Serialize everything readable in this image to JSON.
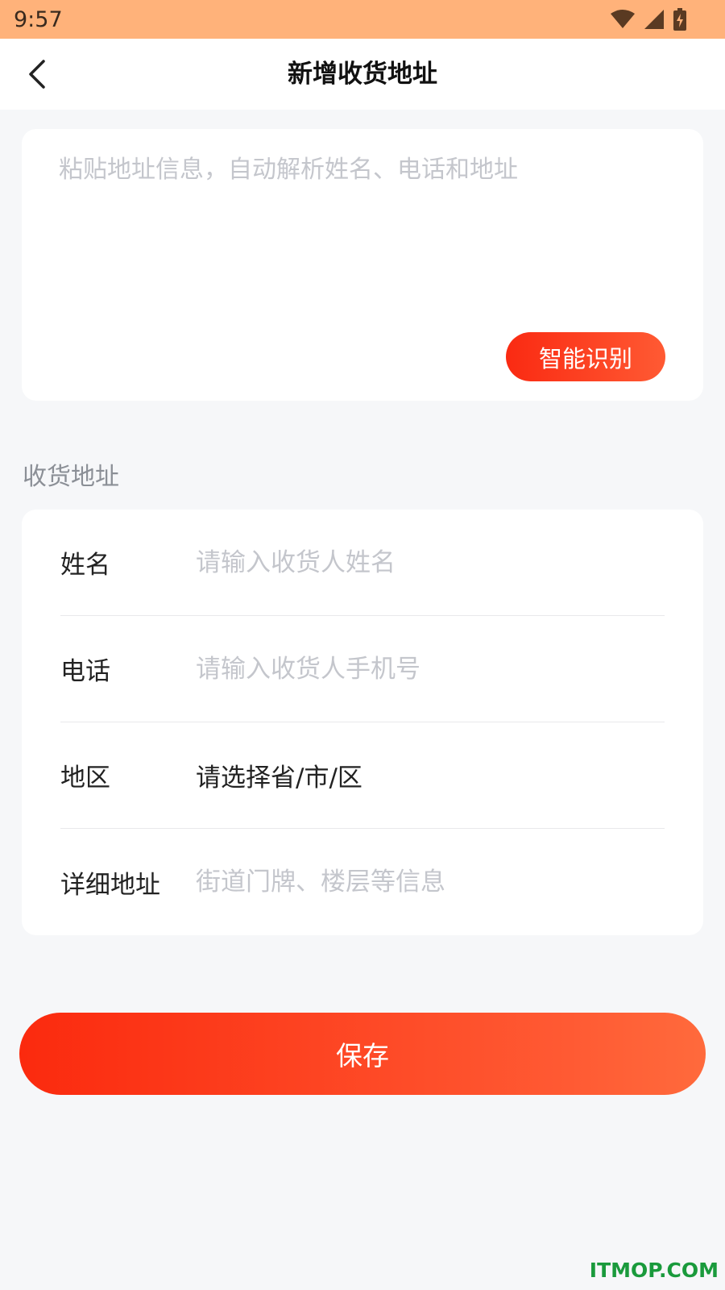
{
  "status_bar": {
    "time": "9:57",
    "icons": [
      "wifi-icon",
      "cellular-signal-icon",
      "battery-charging-icon"
    ],
    "background_color": "#ffb27a"
  },
  "nav": {
    "title": "新增收货地址",
    "back_icon": "chevron-left-icon"
  },
  "paste": {
    "placeholder": "粘贴地址信息，自动解析姓名、电话和地址",
    "button_label": "智能识别"
  },
  "section": {
    "label": "收货地址"
  },
  "form": {
    "name": {
      "label": "姓名",
      "placeholder": "请输入收货人姓名"
    },
    "phone": {
      "label": "电话",
      "placeholder": "请输入收货人手机号"
    },
    "region": {
      "label": "地区",
      "value": "请选择省/市/区"
    },
    "detail": {
      "label": "详细地址",
      "placeholder": "街道门牌、楼层等信息"
    }
  },
  "save": {
    "label": "保存"
  },
  "watermark": "ITMOP.COM",
  "colors": {
    "accent_start": "#fa2a12",
    "accent_end": "#ff5a33",
    "background": "#f6f7f9"
  }
}
